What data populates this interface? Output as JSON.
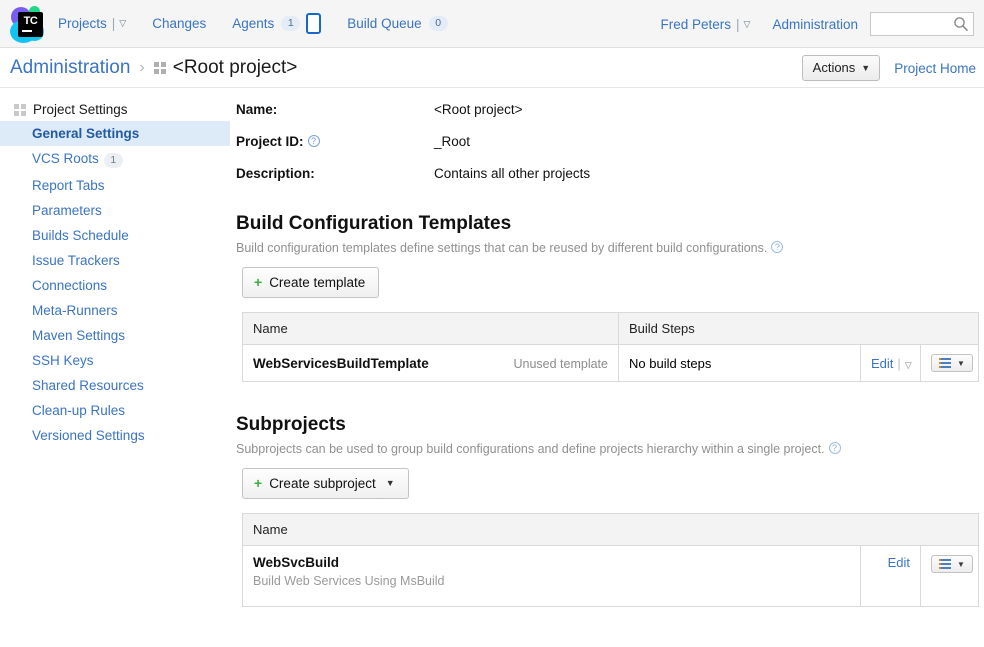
{
  "header": {
    "logo_alt": "TC",
    "nav": [
      {
        "label": "Projects",
        "has_caret": true,
        "badge": null,
        "name": "nav-projects"
      },
      {
        "label": "Changes",
        "has_caret": false,
        "badge": null,
        "name": "nav-changes"
      },
      {
        "label": "Agents",
        "has_caret": false,
        "badge": "1",
        "name": "nav-agents"
      },
      {
        "label": "Build Queue",
        "has_caret": false,
        "badge": "0",
        "name": "nav-build-queue"
      }
    ],
    "user": {
      "label": "Fred Peters",
      "has_caret": true
    },
    "administration_label": "Administration",
    "search": {
      "value": "",
      "placeholder": ""
    }
  },
  "breadcrumb": {
    "root_label": "Administration",
    "separator": "›",
    "current_label": "<Root project>",
    "actions_label": "Actions",
    "project_home_label": "Project Home"
  },
  "sidebar": {
    "heading": "Project Settings",
    "items": [
      {
        "label": "General Settings",
        "badge": null,
        "active": true
      },
      {
        "label": "VCS Roots",
        "badge": "1",
        "active": false
      },
      {
        "label": "Report Tabs",
        "badge": null,
        "active": false
      },
      {
        "label": "Parameters",
        "badge": null,
        "active": false
      },
      {
        "label": "Builds Schedule",
        "badge": null,
        "active": false
      },
      {
        "label": "Issue Trackers",
        "badge": null,
        "active": false
      },
      {
        "label": "Connections",
        "badge": null,
        "active": false
      },
      {
        "label": "Meta-Runners",
        "badge": null,
        "active": false
      },
      {
        "label": "Maven Settings",
        "badge": null,
        "active": false
      },
      {
        "label": "SSH Keys",
        "badge": null,
        "active": false
      },
      {
        "label": "Shared Resources",
        "badge": null,
        "active": false
      },
      {
        "label": "Clean-up Rules",
        "badge": null,
        "active": false
      },
      {
        "label": "Versioned Settings",
        "badge": null,
        "active": false
      }
    ]
  },
  "details": {
    "name_label": "Name:",
    "name_value": "<Root project>",
    "project_id_label": "Project ID:",
    "project_id_value": "_Root",
    "description_label": "Description:",
    "description_value": "Contains all other projects"
  },
  "templates_section": {
    "title": "Build Configuration Templates",
    "description": "Build configuration templates define settings that can be reused by different build configurations.",
    "create_label": "Create template",
    "columns": [
      "Name",
      "Build Steps"
    ],
    "rows": [
      {
        "name": "WebServicesBuildTemplate",
        "status": "Unused template",
        "build_steps": "No build steps",
        "edit_label": "Edit"
      }
    ]
  },
  "subprojects_section": {
    "title": "Subprojects",
    "description": "Subprojects can be used to group build configurations and define projects hierarchy within a single project.",
    "create_label": "Create subproject",
    "columns": [
      "Name"
    ],
    "rows": [
      {
        "name": "WebSvcBuild",
        "description": "Build Web Services Using MsBuild",
        "edit_label": "Edit"
      }
    ]
  },
  "colors": {
    "link": "#3a74c4",
    "accent_green": "#3cb043",
    "active_bg": "#ddeaf7",
    "header_bg": "#f5f5f5"
  }
}
